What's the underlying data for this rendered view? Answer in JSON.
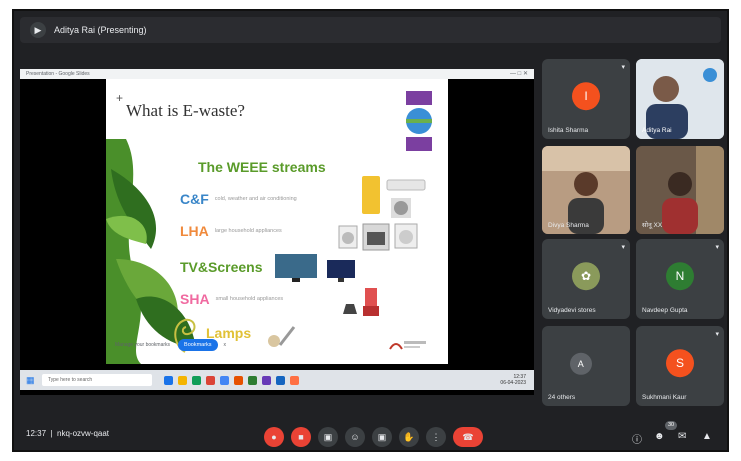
{
  "window": {
    "presenting_title": "Aditya Rai (Presenting)"
  },
  "shared_screen": {
    "browser_tab": "Presentation - Google Slides",
    "slide": {
      "title": "What is E-waste?",
      "subtitle": "The WEEE streams",
      "streams": [
        {
          "label": "C&F",
          "desc": "cold, weather and air conditioning",
          "color": "#3a86c8"
        },
        {
          "label": "LHA",
          "desc": "large household appliances",
          "color": "#f08a3c"
        },
        {
          "label": "TV&Screens",
          "desc": "",
          "color": "#5a9b2a"
        },
        {
          "label": "SHA",
          "desc": "small household appliances",
          "color": "#f06aa0"
        },
        {
          "label": "Lamps",
          "desc": "",
          "color": "#e1c136"
        }
      ],
      "cta_text": "Manage your bookmarks",
      "cta_button": "Bookmarks",
      "cta_dismiss": "x"
    },
    "taskbar": {
      "search_placeholder": "Type here to search",
      "clock_time": "12:37",
      "clock_date": "06-04-2023"
    }
  },
  "participants": [
    {
      "name": "Ishita Sharma",
      "initial": "I",
      "avatar_color": "#f4511e",
      "type": "avatar"
    },
    {
      "name": "Aditya Rai",
      "initial": "",
      "avatar_color": "#555",
      "type": "video"
    },
    {
      "name": "Divya Sharma",
      "initial": "",
      "avatar_color": "#555",
      "type": "video"
    },
    {
      "name": "सोनू XX",
      "initial": "",
      "avatar_color": "#555",
      "type": "video"
    },
    {
      "name": "Vidyadevi stores",
      "initial": "",
      "avatar_color": "#8a9a5b",
      "type": "avatar"
    },
    {
      "name": "Navdeep Gupta",
      "initial": "N",
      "avatar_color": "#2e7d32",
      "type": "avatar"
    },
    {
      "name": "24 others",
      "initial": "",
      "avatar_color": "#5f6368",
      "type": "group"
    },
    {
      "name": "Sukhmani Kaur",
      "initial": "S",
      "avatar_color": "#f4511e",
      "type": "avatar"
    }
  ],
  "meeting_bar": {
    "time": "12:37",
    "meeting_code": "nkq-ozvw-qaat",
    "participant_count": "30"
  }
}
